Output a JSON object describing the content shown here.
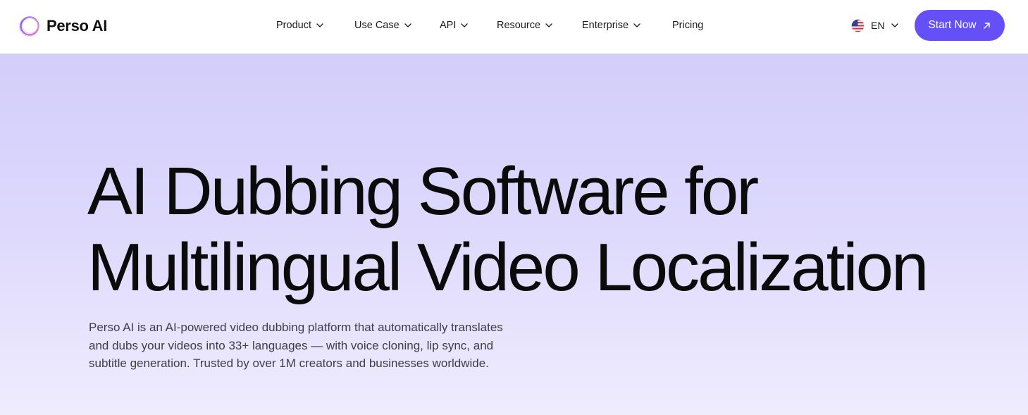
{
  "brand": {
    "name": "Perso AI",
    "accent_color": "#6550f7",
    "logo_icon": "ring-logo-icon"
  },
  "nav": {
    "items": [
      {
        "label": "Product",
        "has_dropdown": true
      },
      {
        "label": "Use Case",
        "has_dropdown": true
      },
      {
        "label": "API",
        "has_dropdown": true
      },
      {
        "label": "Resource",
        "has_dropdown": true
      },
      {
        "label": "Enterprise",
        "has_dropdown": true
      },
      {
        "label": "Pricing",
        "has_dropdown": false
      }
    ],
    "language": {
      "code": "EN",
      "flag_icon": "us-flag-icon"
    },
    "cta": {
      "label": "Start Now",
      "icon": "arrow-up-right-icon"
    }
  },
  "hero": {
    "title_line1": "AI Dubbing Software for",
    "title_line2": "Multilingual Video Localization",
    "description": "Perso AI is an AI-powered video dubbing platform that automatically translates and dubs your videos into 33+ languages — with voice cloning, lip sync, and subtitle generation. Trusted by over 1M creators and businesses worldwide.",
    "background_top": "#d3cdfb",
    "background_bottom": "#efecfe"
  }
}
